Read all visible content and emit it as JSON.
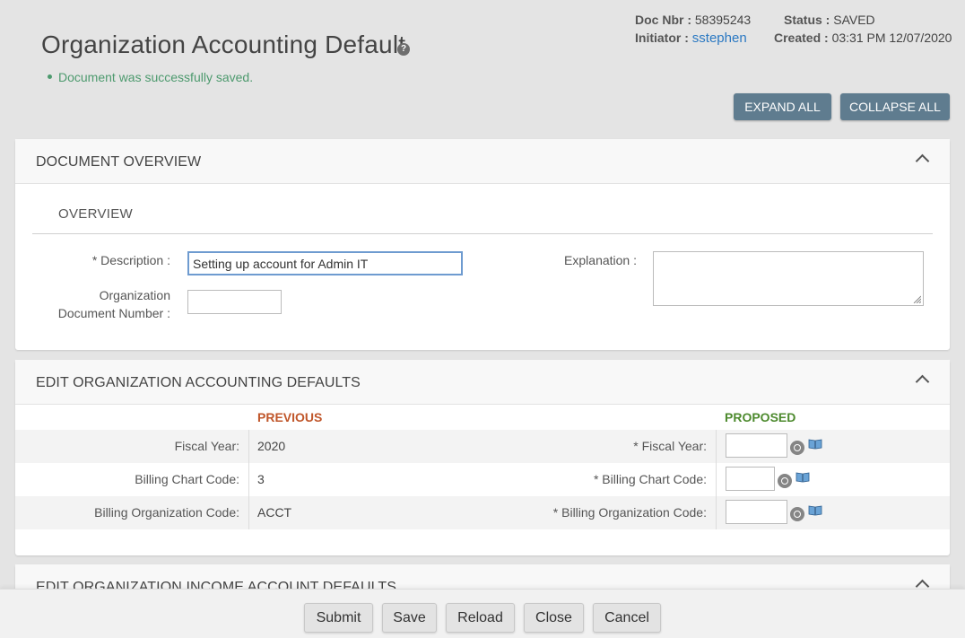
{
  "header": {
    "title": "Organization Accounting Default",
    "help_icon": "?",
    "success_message": "Document was successfully saved.",
    "doc_nbr_label": "Doc Nbr :",
    "doc_nbr": "58395243",
    "initiator_label": "Initiator :",
    "initiator": "sstephen",
    "status_label": "Status :",
    "status": "SAVED",
    "created_label": "Created :",
    "created": "03:31 PM 12/07/2020",
    "expand_all": "EXPAND ALL",
    "collapse_all": "COLLAPSE ALL"
  },
  "document_overview": {
    "title": "DOCUMENT OVERVIEW",
    "subsection": "OVERVIEW",
    "description_label": "* Description :",
    "description_value": "Setting up account for Admin IT",
    "org_doc_number_label_1": "Organization",
    "org_doc_number_label_2": "Document Number :",
    "org_doc_number_value": "",
    "explanation_label": "Explanation :",
    "explanation_value": ""
  },
  "accounting_defaults": {
    "title": "EDIT ORGANIZATION ACCOUNTING DEFAULTS",
    "previous_header": "PREVIOUS",
    "proposed_header": "PROPOSED",
    "previous_color": "#c0562a",
    "proposed_color": "#4d8a2e",
    "rows": [
      {
        "label": "Fiscal Year:",
        "previous": "2020",
        "proposed_label": "* Fiscal Year:",
        "proposed": ""
      },
      {
        "label": "Billing Chart Code:",
        "previous": "3",
        "proposed_label": "* Billing Chart Code:",
        "proposed": ""
      },
      {
        "label": "Billing Organization Code:",
        "previous": "ACCT",
        "proposed_label": "* Billing Organization Code:",
        "proposed": ""
      }
    ]
  },
  "income_defaults": {
    "title": "EDIT ORGANIZATION INCOME ACCOUNT DEFAULTS"
  },
  "footer": {
    "submit": "Submit",
    "save": "Save",
    "reload": "Reload",
    "close": "Close",
    "cancel": "Cancel"
  }
}
